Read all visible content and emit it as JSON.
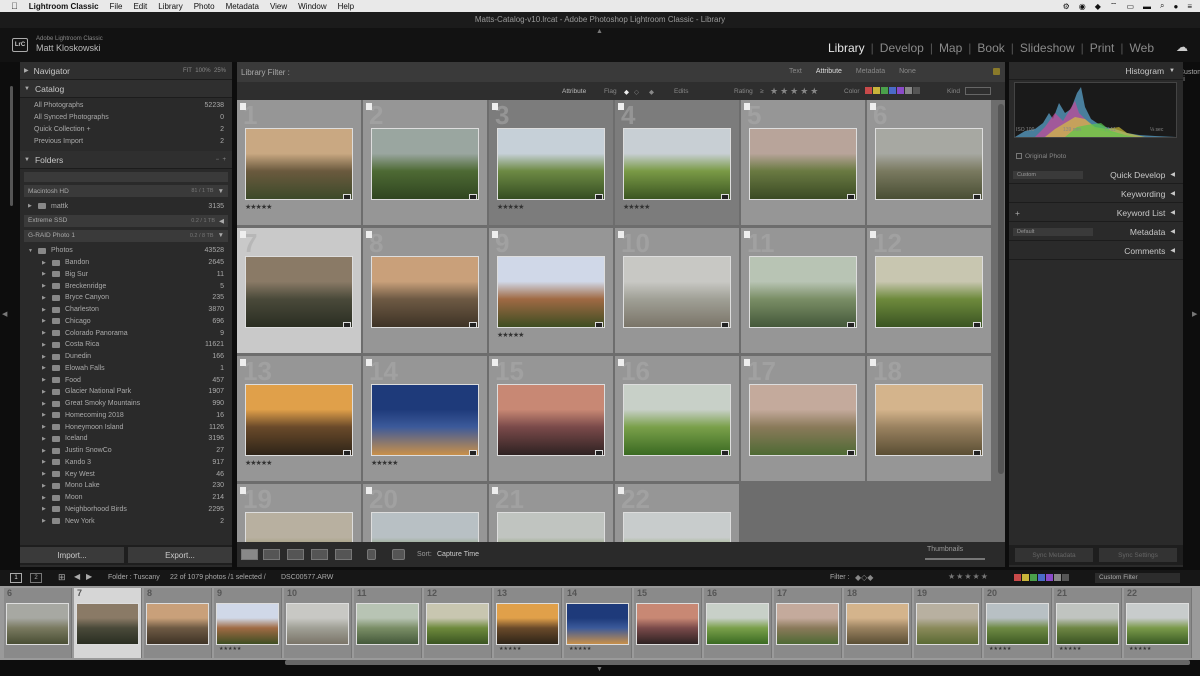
{
  "menubar": {
    "app": "Lightroom Classic",
    "items": [
      "File",
      "Edit",
      "Library",
      "Photo",
      "Metadata",
      "View",
      "Window",
      "Help"
    ]
  },
  "window": {
    "title": "Matts-Catalog-v10.lrcat - Adobe Photoshop Lightroom Classic - Library"
  },
  "identity": {
    "logo": "LrC",
    "app": "Adobe Lightroom Classic",
    "user": "Matt Kloskowski"
  },
  "modules": [
    {
      "label": "Library",
      "active": true
    },
    {
      "label": "Develop"
    },
    {
      "label": "Map"
    },
    {
      "label": "Book"
    },
    {
      "label": "Slideshow"
    },
    {
      "label": "Print"
    },
    {
      "label": "Web"
    }
  ],
  "left": {
    "navigator": {
      "label": "Navigator",
      "zoom": [
        "FIT",
        "100%",
        "25%"
      ]
    },
    "catalog": {
      "label": "Catalog",
      "items": [
        {
          "label": "All Photographs",
          "count": "52238"
        },
        {
          "label": "All Synced Photographs",
          "count": "0"
        },
        {
          "label": "Quick Collection +",
          "count": "2"
        },
        {
          "label": "Previous Import",
          "count": "2"
        }
      ]
    },
    "folders": {
      "label": "Folders",
      "volumes": [
        {
          "label": "Macintosh HD",
          "info": "81 / 1 TB"
        },
        {
          "label": "Extreme SSD",
          "info": "0.2 / 1 TB"
        },
        {
          "label": "G-RAID Photo 1",
          "info": "0.2 / 8 TB"
        }
      ],
      "mattk": {
        "label": "mattk",
        "count": "3135"
      },
      "photos": {
        "label": "Photos",
        "count": "43528"
      },
      "subfolders": [
        {
          "label": "Bandon",
          "count": "2645"
        },
        {
          "label": "Big Sur",
          "count": "11"
        },
        {
          "label": "Breckenridge",
          "count": "5"
        },
        {
          "label": "Bryce Canyon",
          "count": "235"
        },
        {
          "label": "Charleston",
          "count": "3870"
        },
        {
          "label": "Chicago",
          "count": "696"
        },
        {
          "label": "Colorado Panorama",
          "count": "9"
        },
        {
          "label": "Costa Rica",
          "count": "11621"
        },
        {
          "label": "Dunedin",
          "count": "166"
        },
        {
          "label": "Elowah Falls",
          "count": "1"
        },
        {
          "label": "Food",
          "count": "457"
        },
        {
          "label": "Glacier National Park",
          "count": "1907"
        },
        {
          "label": "Great Smoky Mountains",
          "count": "990"
        },
        {
          "label": "Homecoming 2018",
          "count": "16"
        },
        {
          "label": "Honeymoon Island",
          "count": "1126"
        },
        {
          "label": "Iceland",
          "count": "3196"
        },
        {
          "label": "Justin SnowCo",
          "count": "27"
        },
        {
          "label": "Kando 3",
          "count": "917"
        },
        {
          "label": "Key West",
          "count": "46"
        },
        {
          "label": "Mono Lake",
          "count": "230"
        },
        {
          "label": "Moon",
          "count": "214"
        },
        {
          "label": "Neighborhood Birds",
          "count": "2295"
        },
        {
          "label": "New York",
          "count": "2"
        }
      ]
    },
    "import_label": "Import...",
    "export_label": "Export..."
  },
  "filter": {
    "label": "Library Filter :",
    "tabs": [
      "Text",
      "Attribute",
      "Metadata",
      "None"
    ],
    "active_tab": "Attribute",
    "custom": "Custom Fi",
    "attr_label": "Attribute",
    "flag_label": "Flag",
    "edits_label": "Edits",
    "rating_label": "Rating",
    "rating_op": "≥",
    "color_label": "Color",
    "kind_label": "Kind"
  },
  "grid": {
    "cells": [
      {
        "idx": "1",
        "stars": "★★★★★",
        "tone": "normal",
        "palette": [
          "#c9a882",
          "#6b5a3e",
          "#3c4a2a"
        ]
      },
      {
        "idx": "2",
        "stars": "",
        "tone": "normal",
        "palette": [
          "#9aa6a0",
          "#4e6a34",
          "#2f4520"
        ]
      },
      {
        "idx": "3",
        "stars": "★★★★★",
        "tone": "dark",
        "palette": [
          "#c6d0d8",
          "#6d8a44",
          "#354d22"
        ]
      },
      {
        "idx": "4",
        "stars": "★★★★★",
        "tone": "dark",
        "palette": [
          "#c8cfd4",
          "#7a9a46",
          "#3b5522"
        ]
      },
      {
        "idx": "5",
        "stars": "",
        "tone": "normal",
        "palette": [
          "#b8a49a",
          "#6a7a42",
          "#3a4a24"
        ]
      },
      {
        "idx": "6",
        "stars": "",
        "tone": "normal",
        "palette": [
          "#a7a8a2",
          "#7a7a60",
          "#494e34"
        ]
      },
      {
        "idx": "7",
        "stars": "",
        "tone": "sel",
        "palette": [
          "#8a7a66",
          "#4a4a3a",
          "#2a2e22"
        ]
      },
      {
        "idx": "8",
        "stars": "",
        "tone": "normal",
        "palette": [
          "#c9a07a",
          "#6e5a44",
          "#3e3326"
        ]
      },
      {
        "idx": "9",
        "stars": "★★★★★",
        "tone": "normal",
        "palette": [
          "#d0d8e8",
          "#a06a44",
          "#3e4e22"
        ]
      },
      {
        "idx": "10",
        "stars": "",
        "tone": "normal",
        "palette": [
          "#c8c8c4",
          "#a0a096",
          "#7a7468"
        ]
      },
      {
        "idx": "11",
        "stars": "",
        "tone": "normal",
        "palette": [
          "#b8c4b4",
          "#7a8e66",
          "#44583a"
        ]
      },
      {
        "idx": "12",
        "stars": "",
        "tone": "normal",
        "palette": [
          "#c8c6b0",
          "#6e8a3c",
          "#3a5422"
        ]
      },
      {
        "idx": "13",
        "stars": "★★★★★",
        "tone": "normal",
        "palette": [
          "#e0a04a",
          "#6a4a2a",
          "#2e2418"
        ]
      },
      {
        "idx": "14",
        "stars": "★★★★★",
        "tone": "normal",
        "palette": [
          "#1e3a7a",
          "#3c5a9a",
          "#c8904a"
        ]
      },
      {
        "idx": "15",
        "stars": "",
        "tone": "normal",
        "palette": [
          "#c88874",
          "#7a4a4a",
          "#2e2222"
        ]
      },
      {
        "idx": "16",
        "stars": "",
        "tone": "normal",
        "palette": [
          "#c8d0c8",
          "#7aa04a",
          "#3a6a22"
        ]
      },
      {
        "idx": "17",
        "stars": "",
        "tone": "normal",
        "palette": [
          "#c4aa9c",
          "#8a7a5a",
          "#4e6a34"
        ]
      },
      {
        "idx": "18",
        "stars": "",
        "tone": "normal",
        "palette": [
          "#d4b48c",
          "#9a8260",
          "#5a4e34"
        ]
      },
      {
        "idx": "19",
        "stars": "",
        "tone": "normal",
        "palette": [
          "#b8b0a0",
          "#8a8a5a",
          "#5a6a34"
        ]
      },
      {
        "idx": "20",
        "stars": "",
        "tone": "normal",
        "palette": [
          "#b8c0c4",
          "#6e8a44",
          "#3e5a24"
        ]
      },
      {
        "idx": "21",
        "stars": "",
        "tone": "normal",
        "palette": [
          "#c0c4c0",
          "#6e8644",
          "#3a5422"
        ]
      },
      {
        "idx": "22",
        "stars": "",
        "tone": "normal",
        "palette": [
          "#c8cccc",
          "#7a9a4a",
          "#3a5a24"
        ]
      }
    ]
  },
  "toolbar": {
    "sort_label": "Sort:",
    "sort_value": "Capture Time",
    "thumbs_label": "Thumbnails"
  },
  "right": {
    "histogram_label": "Histogram",
    "exif": [
      "ISO 100",
      "139 mm",
      "f / 11",
      "⅛ sec"
    ],
    "original_photo": "Original Photo",
    "quick_develop": "Quick Develop",
    "qd_preset": "Custom",
    "keywording": "Keywording",
    "keyword_list": "Keyword List",
    "metadata": "Metadata",
    "md_preset": "Default",
    "comments": "Comments",
    "sync_metadata": "Sync Metadata",
    "sync_settings": "Sync Settings"
  },
  "filmstrip": {
    "folder": "Folder : Tuscany",
    "count": "22 of 1079 photos /1 selected /",
    "filename": "DSC00577.ARW",
    "filter_label": "Filter :",
    "custom_filter": "Custom Filter",
    "cells": [
      {
        "idx": "6",
        "stars": ""
      },
      {
        "idx": "7",
        "stars": "",
        "sel": true
      },
      {
        "idx": "8",
        "stars": ""
      },
      {
        "idx": "9",
        "stars": "★★★★★"
      },
      {
        "idx": "10",
        "stars": ""
      },
      {
        "idx": "11",
        "stars": ""
      },
      {
        "idx": "12",
        "stars": ""
      },
      {
        "idx": "13",
        "stars": "★★★★★"
      },
      {
        "idx": "14",
        "stars": "★★★★★"
      },
      {
        "idx": "15",
        "stars": ""
      },
      {
        "idx": "16",
        "stars": ""
      },
      {
        "idx": "17",
        "stars": ""
      },
      {
        "idx": "18",
        "stars": ""
      },
      {
        "idx": "19",
        "stars": ""
      },
      {
        "idx": "20",
        "stars": "★★★★★"
      },
      {
        "idx": "21",
        "stars": "★★★★★"
      },
      {
        "idx": "22",
        "stars": "★★★★★"
      }
    ]
  }
}
